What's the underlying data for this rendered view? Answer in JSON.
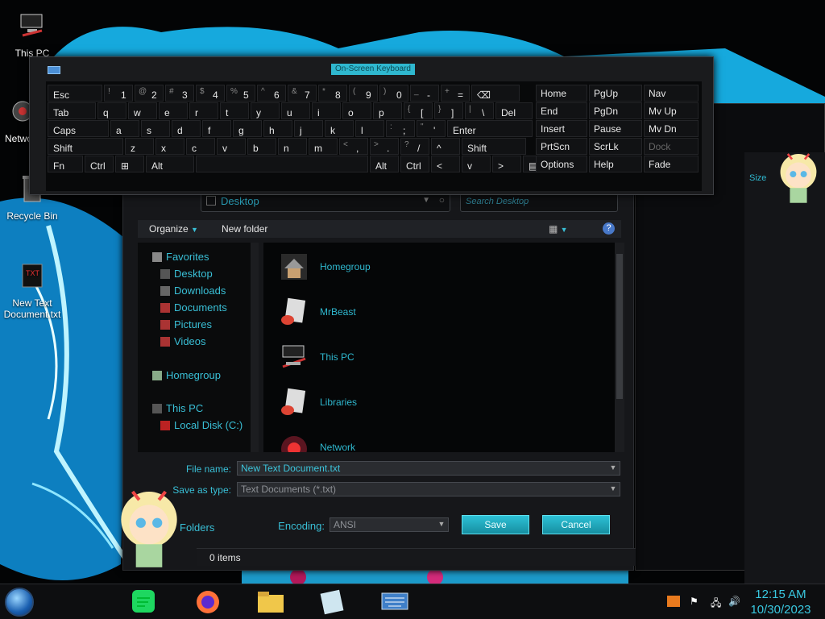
{
  "desktop": {
    "icons": [
      {
        "label": "This PC"
      },
      {
        "label": "Network"
      },
      {
        "label": "Recycle Bin"
      },
      {
        "label": "New Text Document.txt"
      }
    ]
  },
  "keyboard": {
    "title": "On-Screen Keyboard",
    "rows": [
      [
        {
          "label": "Esc"
        },
        {
          "label": "1",
          "sub": "!"
        },
        {
          "label": "2",
          "sub": "@"
        },
        {
          "label": "3",
          "sub": "#"
        },
        {
          "label": "4",
          "sub": "$"
        },
        {
          "label": "5",
          "sub": "%"
        },
        {
          "label": "6",
          "sub": "^"
        },
        {
          "label": "7",
          "sub": "&"
        },
        {
          "label": "8",
          "sub": "*"
        },
        {
          "label": "9",
          "sub": "("
        },
        {
          "label": "0",
          "sub": ")"
        },
        {
          "label": "-",
          "sub": "_"
        },
        {
          "label": "=",
          "sub": "+"
        },
        {
          "label": "⌫"
        }
      ],
      [
        {
          "label": "Tab"
        },
        {
          "label": "q"
        },
        {
          "label": "w"
        },
        {
          "label": "e"
        },
        {
          "label": "r"
        },
        {
          "label": "t"
        },
        {
          "label": "y"
        },
        {
          "label": "u"
        },
        {
          "label": "i"
        },
        {
          "label": "o"
        },
        {
          "label": "p"
        },
        {
          "label": "[",
          "sub": "{"
        },
        {
          "label": "]",
          "sub": "}"
        },
        {
          "label": "\\",
          "sub": "|"
        },
        {
          "label": "Del"
        }
      ],
      [
        {
          "label": "Caps"
        },
        {
          "label": "a"
        },
        {
          "label": "s"
        },
        {
          "label": "d"
        },
        {
          "label": "f"
        },
        {
          "label": "g"
        },
        {
          "label": "h"
        },
        {
          "label": "j"
        },
        {
          "label": "k"
        },
        {
          "label": "l"
        },
        {
          "label": ";",
          "sub": ":"
        },
        {
          "label": "'",
          "sub": "\""
        },
        {
          "label": "Enter"
        }
      ],
      [
        {
          "label": "Shift"
        },
        {
          "label": "z"
        },
        {
          "label": "x"
        },
        {
          "label": "c"
        },
        {
          "label": "v"
        },
        {
          "label": "b"
        },
        {
          "label": "n"
        },
        {
          "label": "m"
        },
        {
          "label": ",",
          "sub": "<"
        },
        {
          "label": ".",
          "sub": ">"
        },
        {
          "label": "/",
          "sub": "?"
        },
        {
          "label": "^"
        },
        {
          "label": "Shift"
        }
      ],
      [
        {
          "label": "Fn"
        },
        {
          "label": "Ctrl"
        },
        {
          "label": "⊞"
        },
        {
          "label": "Alt"
        },
        {
          "label": ""
        },
        {
          "label": "Alt"
        },
        {
          "label": "Ctrl"
        },
        {
          "label": "<"
        },
        {
          "label": "v"
        },
        {
          "label": ">"
        },
        {
          "label": "▤"
        }
      ]
    ],
    "nav_keys": [
      [
        "Home",
        "PgUp",
        "Nav"
      ],
      [
        "End",
        "PgDn",
        "Mv Up"
      ],
      [
        "Insert",
        "Pause",
        "Mv Dn"
      ],
      [
        "PrtScn",
        "ScrLk",
        "Dock"
      ],
      [
        "Options",
        "Help",
        "Fade"
      ]
    ]
  },
  "dialog": {
    "address": "Desktop",
    "search_placeholder": "Search Desktop",
    "toolbar": {
      "organize": "Organize",
      "new_folder": "New folder",
      "help": "?"
    },
    "nav": [
      {
        "label": "Favorites",
        "icon": "star-icon"
      },
      {
        "label": "Desktop",
        "icon": "desktop-icon"
      },
      {
        "label": "Downloads",
        "icon": "downloads-icon"
      },
      {
        "label": "Documents",
        "icon": "documents-icon"
      },
      {
        "label": "Pictures",
        "icon": "pictures-icon"
      },
      {
        "label": "Videos",
        "icon": "videos-icon"
      },
      {
        "label": "Homegroup",
        "icon": "homegroup-icon"
      },
      {
        "label": "This PC",
        "icon": "computer-icon"
      },
      {
        "label": "Local Disk (C:)",
        "icon": "drive-icon"
      }
    ],
    "files": [
      {
        "label": "Homegroup"
      },
      {
        "label": "MrBeast"
      },
      {
        "label": "This PC"
      },
      {
        "label": "Libraries"
      },
      {
        "label": "Network"
      }
    ],
    "file_name_label": "File name:",
    "file_name": "New Text Document.txt",
    "save_type_label": "Save as type:",
    "save_type": "Text Documents (*.txt)",
    "hide_folders": "Folders",
    "encoding_label": "Encoding:",
    "encoding": "ANSI",
    "save": "Save",
    "cancel": "Cancel"
  },
  "statusbar": {
    "text": "0 items"
  },
  "bg_window": {
    "column": "Size"
  },
  "taskbar": {
    "apps": [
      "spotify-icon",
      "firefox-icon",
      "file-explorer-icon",
      "notepad-icon",
      "on-screen-keyboard-icon"
    ],
    "time": "12:15 AM",
    "date": "10/30/2023"
  }
}
